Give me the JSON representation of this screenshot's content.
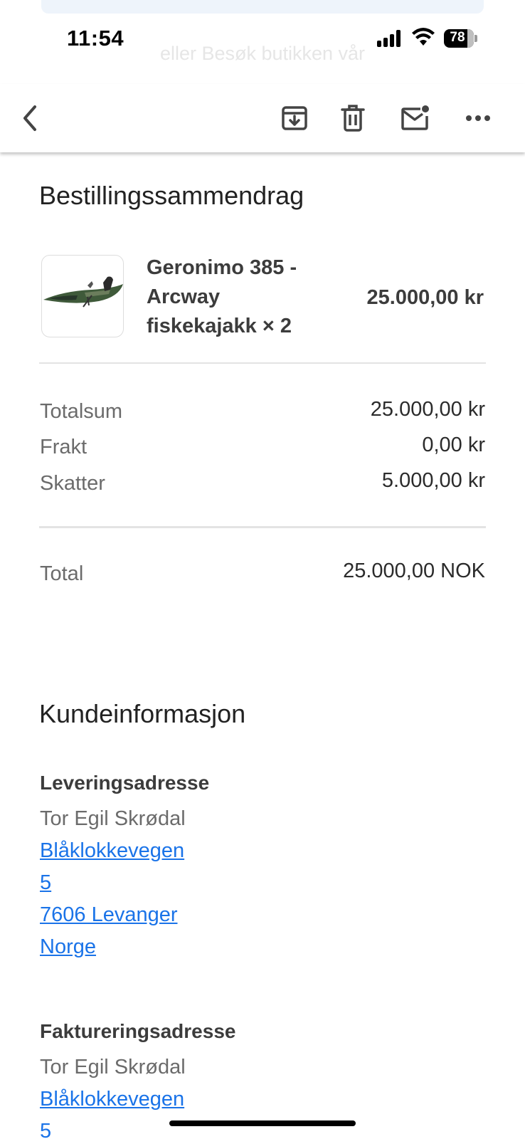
{
  "status_bar": {
    "time": "11:54",
    "battery": "78",
    "battery_level_percent": 78
  },
  "background_text": "eller Besøk butikken vår",
  "toolbar": {
    "icons": [
      "back-arrow-icon",
      "archive-icon",
      "trash-icon",
      "mark-unread-icon",
      "more-icon"
    ]
  },
  "order_summary": {
    "title": "Bestillingssammendrag",
    "item": {
      "name_lines": [
        "Geronimo 385 -",
        "Arcway",
        "fiskekajakk × 2"
      ],
      "price": "25.000,00 kr"
    },
    "rows": [
      {
        "label": "Totalsum",
        "value": "25.000,00 kr"
      },
      {
        "label": "Frakt",
        "value": "0,00 kr"
      },
      {
        "label": "Skatter",
        "value": "5.000,00 kr"
      }
    ],
    "total": {
      "label": "Total",
      "value": "25.000,00 NOK"
    }
  },
  "customer_info": {
    "title": "Kundeinformasjon",
    "shipping": {
      "heading": "Leveringsadresse",
      "name": "Tor Egil Skrødal",
      "links": [
        "Blåklokkevegen",
        "5",
        "7606 Levanger",
        "Norge"
      ]
    },
    "billing": {
      "heading": "Faktureringsadresse",
      "name": "Tor Egil Skrødal",
      "links": [
        "Blåklokkevegen",
        "5"
      ]
    }
  },
  "colors": {
    "link": "#1a73e8",
    "muted_text": "#6b6b6b",
    "divider": "#e3e3e3"
  }
}
